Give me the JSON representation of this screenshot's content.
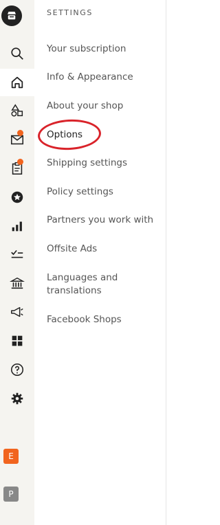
{
  "sidebar": {
    "heading": "SETTINGS",
    "items": [
      {
        "label": "Your subscription"
      },
      {
        "label": "Info & Appearance"
      },
      {
        "label": "About your shop"
      },
      {
        "label": "Options"
      },
      {
        "label": "Shipping settings"
      },
      {
        "label": "Policy settings"
      },
      {
        "label": "Partners you work with"
      },
      {
        "label": "Offsite Ads"
      },
      {
        "label": "Languages and translations"
      },
      {
        "label": "Facebook Shops"
      }
    ]
  },
  "rail": {
    "icons": [
      "shop-logo-icon",
      "search-icon",
      "home-icon",
      "listings-icon",
      "messages-icon",
      "orders-icon",
      "star-seller-icon",
      "stats-icon",
      "marketing-checklist-icon",
      "finances-icon",
      "marketing-icon",
      "integrations-icon",
      "help-icon",
      "settings-icon"
    ],
    "notification_color": "#f1641e",
    "avatars": [
      {
        "letter": "E",
        "color": "#f1641e"
      },
      {
        "letter": "P",
        "color": "#888888"
      }
    ]
  },
  "annotation": {
    "color": "#d9232a",
    "target": "Options"
  }
}
